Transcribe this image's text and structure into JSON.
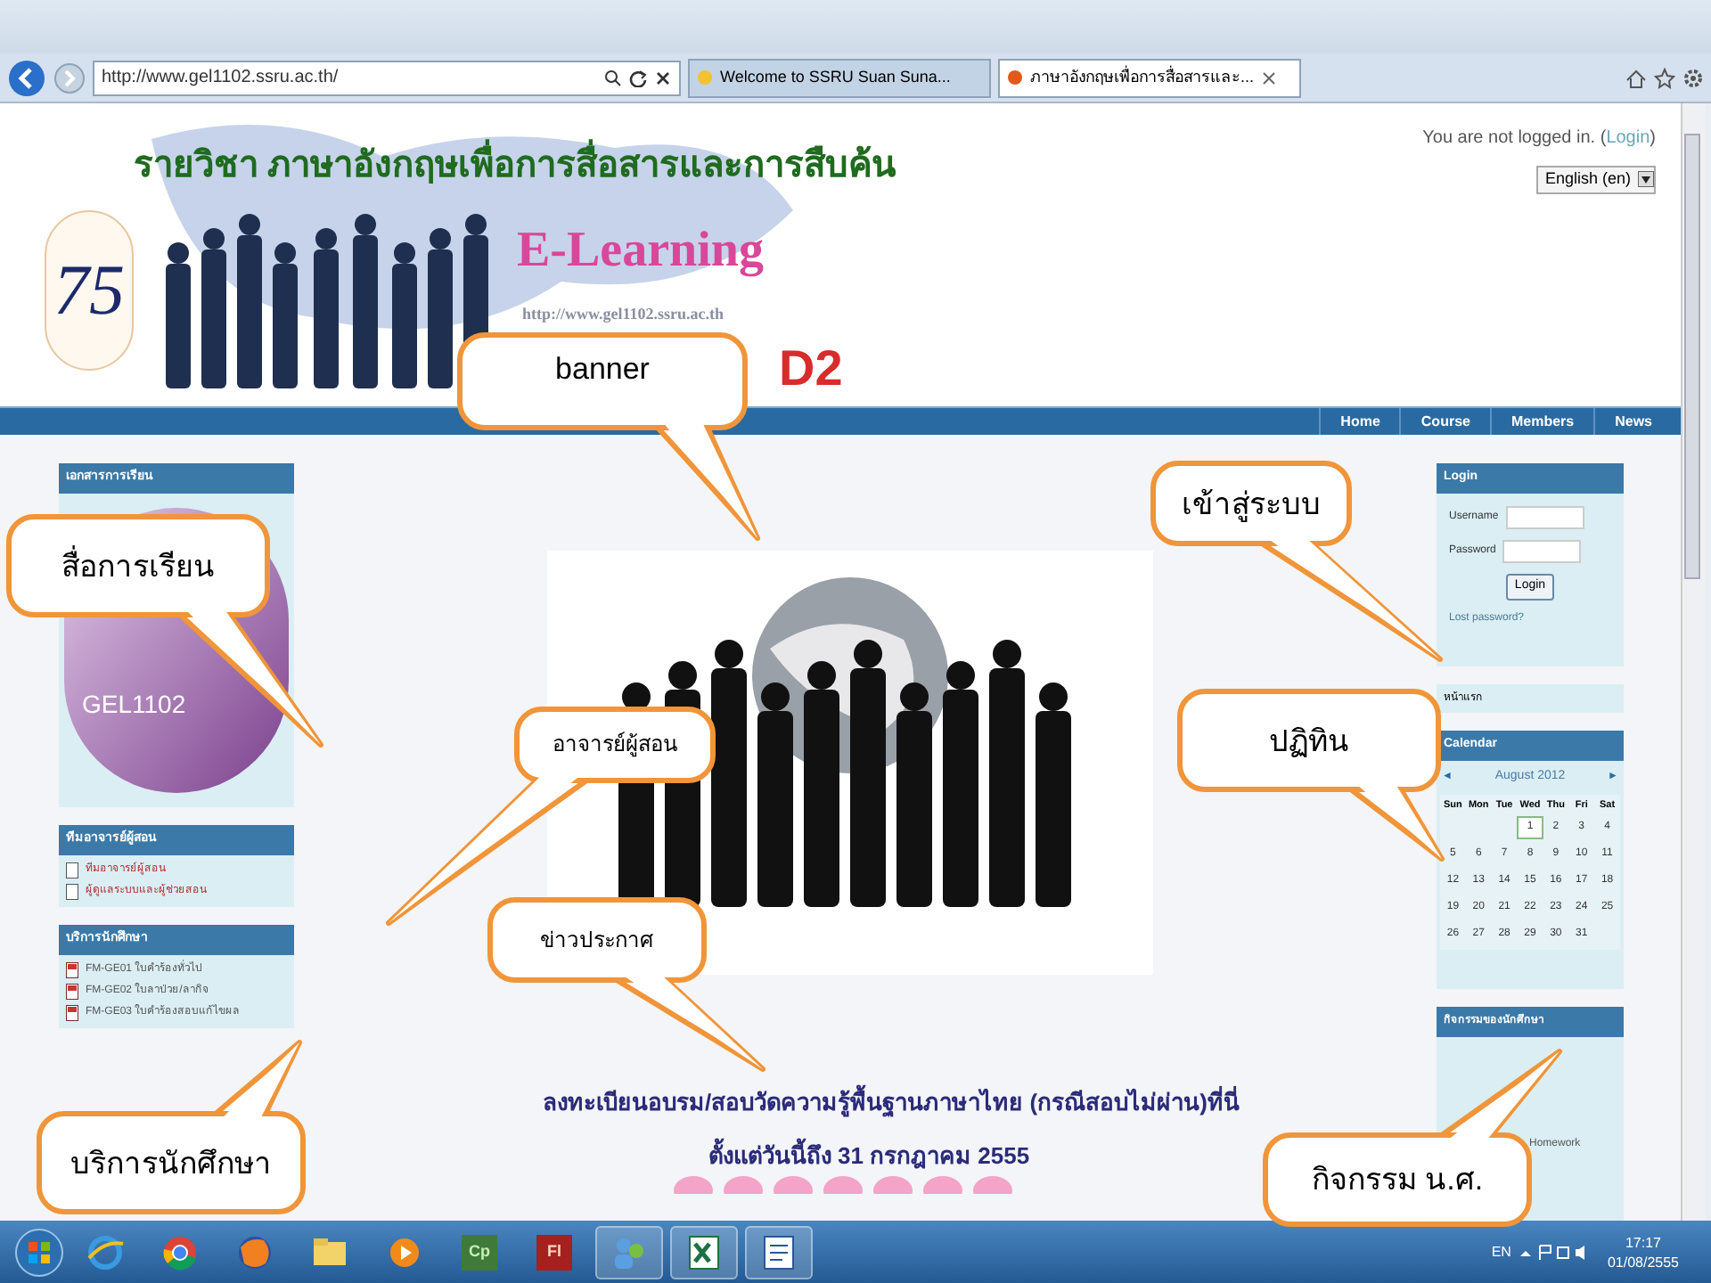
{
  "browser": {
    "url": "http://www.gel1102.ssru.ac.th/",
    "tabs": [
      {
        "label": "Welcome to SSRU Suan Suna...",
        "selected": false
      },
      {
        "label": "ภาษาอังกฤษเพื่อการสื่อสารและ...",
        "selected": true
      }
    ]
  },
  "banner": {
    "course_title": "รายวิชา ภาษาอังกฤษเพื่อการสื่อสารและการสืบค้น",
    "emblem": "75",
    "heading": "E-Learning",
    "site_url": "http://www.gel1102.ssru.ac.th",
    "code_fragment": "D2"
  },
  "login_status": {
    "before": "You are not logged in. (",
    "link": "Login",
    "after": ")"
  },
  "language": "English (en)",
  "nav": [
    "Home",
    "Course",
    "Members",
    "News"
  ],
  "left_blocks": [
    {
      "title": "เอกสารการเรียน",
      "kind": "image",
      "image_text": "GEL1102"
    },
    {
      "title": "ทีมอาจารย์ผู้สอน",
      "kind": "links",
      "items": [
        "ทีมอาจารย์ผู้สอน",
        "ผู้ดูแลระบบและผู้ช่วยสอน"
      ]
    },
    {
      "title": "บริการนักศึกษา",
      "kind": "files",
      "items": [
        "FM-GE01 ใบคำร้องทั่วไป",
        "FM-GE02 ใบลาป่วย/ลากิจ",
        "FM-GE03 ใบคำร้องสอบแก้ไขผล"
      ]
    }
  ],
  "announcement": [
    "ลงทะเบียนอบรม/สอบวัดความรู้พื้นฐานภาษาไทย (กรณีสอบไม่ผ่าน)ที่นี่",
    "ตั้งแต่วันนี้ถึง 31 กรกฎาคม 2555"
  ],
  "login_block": {
    "title": "Login",
    "username_label": "Username",
    "password_label": "Password",
    "button": "Login",
    "lost_password": "Lost password?"
  },
  "home_block": "หน้าแรก",
  "calendar": {
    "title": "Calendar",
    "month": "August 2012",
    "prev": "◄",
    "next": "►",
    "weekdays": [
      "Sun",
      "Mon",
      "Tue",
      "Wed",
      "Thu",
      "Fri",
      "Sat"
    ],
    "weeks": [
      [
        {
          "kind": "blank"
        },
        {
          "kind": "blank"
        },
        {
          "kind": "blank"
        },
        {
          "kind": "day",
          "d": "1",
          "today": true
        },
        {
          "d": "2",
          "today": false
        },
        {
          "d": "3",
          "today": false
        },
        {
          "d": "4",
          "today": false
        }
      ],
      [
        {
          "d": "5",
          "today": false
        },
        {
          "d": "6",
          "today": false
        },
        {
          "d": "7",
          "today": false
        },
        {
          "d": "8",
          "today": false
        },
        {
          "d": "9",
          "today": false
        },
        {
          "d": "10",
          "today": false
        },
        {
          "d": "11",
          "today": false
        }
      ],
      [
        {
          "d": "12",
          "today": false
        },
        {
          "d": "13",
          "today": false
        },
        {
          "d": "14",
          "today": false
        },
        {
          "d": "15",
          "today": false
        },
        {
          "d": "16",
          "today": false
        },
        {
          "d": "17",
          "today": false
        },
        {
          "d": "18",
          "today": false
        }
      ],
      [
        {
          "d": "19",
          "today": false
        },
        {
          "d": "20",
          "today": false
        },
        {
          "d": "21",
          "today": false
        },
        {
          "d": "22",
          "today": false
        },
        {
          "d": "23",
          "today": false
        },
        {
          "d": "24",
          "today": false
        },
        {
          "d": "25",
          "today": false
        }
      ],
      [
        {
          "d": "26",
          "today": false
        },
        {
          "d": "27",
          "today": false
        },
        {
          "d": "28",
          "today": false
        },
        {
          "d": "29",
          "today": false
        },
        {
          "d": "30",
          "today": false
        },
        {
          "d": "31",
          "today": false
        },
        {
          "kind": "blank"
        }
      ]
    ]
  },
  "activity_block": {
    "title": "กิจกรรมของนักศึกษา",
    "items": [
      "Homework"
    ]
  },
  "callouts": [
    "banner",
    "สื่อการเรียน",
    "อาจารย์ผู้สอน",
    "ข่าวประกาศ",
    "เข้าสู่ระบบ",
    "ปฏิทิน",
    "บริการนักศึกษา",
    "กิจกรรม น.ศ."
  ],
  "taskbar": {
    "app_labels": [
      "Cp",
      "Fl"
    ],
    "language": "EN",
    "time": "17:17",
    "date": "01/08/2555"
  }
}
